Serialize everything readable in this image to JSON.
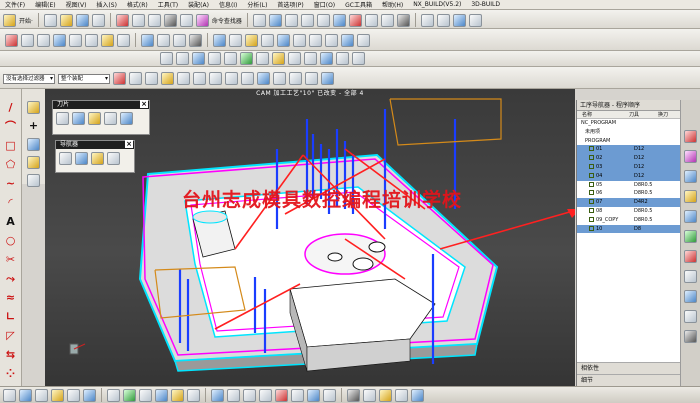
{
  "menubar": {
    "items": [
      "文件(F)",
      "编辑(E)",
      "视图(V)",
      "插入(S)",
      "格式(R)",
      "工具(T)",
      "装配(A)",
      "信息(I)",
      "分析(L)",
      "首选项(P)",
      "窗口(O)",
      "GC工具箱",
      "帮助(H)",
      "NX_BUILD(V5.2)",
      "3D-BUILD"
    ]
  },
  "toolbar1": {
    "start_label": "开始·",
    "cmd_finder": "命令查找器"
  },
  "toolbar4": {
    "filter_value": "没有选择过滤器",
    "assembly_value": "整个装配"
  },
  "viewport": {
    "title": "CAM 加工工艺\"10\" 已改变 - 全部 4",
    "watermark": "台州志成模具数控编程培训学校"
  },
  "palettes": {
    "tools_title": "刀片",
    "navigator_title": "导航器"
  },
  "navigator": {
    "title": "工序导航器 - 程序顺序",
    "columns": {
      "name": "名称",
      "tool": "刀具",
      "change": "换刀"
    },
    "rows": [
      {
        "name": "NC_PROGRAM",
        "tool": "",
        "sel": false,
        "indent": 0
      },
      {
        "name": "未用项",
        "tool": "",
        "sel": false,
        "indent": 1
      },
      {
        "name": "PROGRAM",
        "tool": "",
        "sel": false,
        "indent": 1
      },
      {
        "name": "01",
        "tool": "D12",
        "sel": true,
        "indent": 2
      },
      {
        "name": "02",
        "tool": "D12",
        "sel": true,
        "indent": 2
      },
      {
        "name": "03",
        "tool": "D12",
        "sel": true,
        "indent": 2
      },
      {
        "name": "04",
        "tool": "D12",
        "sel": true,
        "indent": 2
      },
      {
        "name": "05",
        "tool": "D8R0.5",
        "sel": false,
        "indent": 2
      },
      {
        "name": "06",
        "tool": "D8R0.5",
        "sel": false,
        "indent": 2
      },
      {
        "name": "07",
        "tool": "D4R2",
        "sel": true,
        "indent": 2
      },
      {
        "name": "08",
        "tool": "D8R0.5",
        "sel": false,
        "indent": 2
      },
      {
        "name": "09_COPY",
        "tool": "D8R0.5",
        "sel": false,
        "indent": 2
      },
      {
        "name": "10",
        "tool": "D8",
        "sel": true,
        "indent": 2
      }
    ],
    "footer": {
      "dependencies": "相依性",
      "details": "细节"
    }
  },
  "colors": {
    "selection": "#6c9bd2",
    "watermark": "#e3141b",
    "part_edge": "#00e5ff",
    "part_outline": "#ff00ff",
    "tool_path": "#1a3dff",
    "arrows": "#ff2020"
  }
}
